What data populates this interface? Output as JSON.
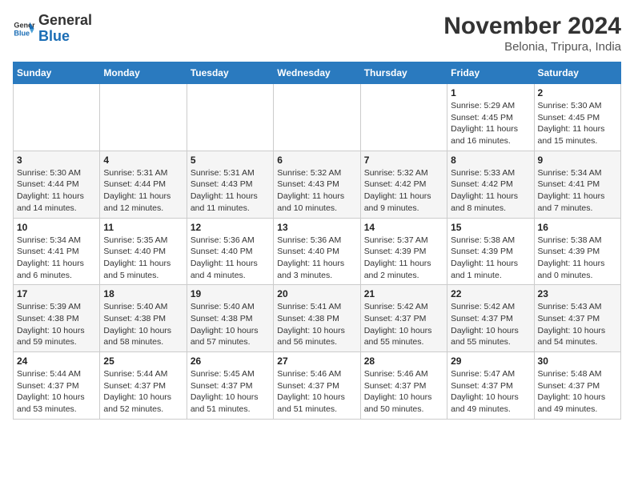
{
  "header": {
    "logo_line1": "General",
    "logo_line2": "Blue",
    "month": "November 2024",
    "location": "Belonia, Tripura, India"
  },
  "weekdays": [
    "Sunday",
    "Monday",
    "Tuesday",
    "Wednesday",
    "Thursday",
    "Friday",
    "Saturday"
  ],
  "weeks": [
    [
      {
        "day": "",
        "info": ""
      },
      {
        "day": "",
        "info": ""
      },
      {
        "day": "",
        "info": ""
      },
      {
        "day": "",
        "info": ""
      },
      {
        "day": "",
        "info": ""
      },
      {
        "day": "1",
        "info": "Sunrise: 5:29 AM\nSunset: 4:45 PM\nDaylight: 11 hours and 16 minutes."
      },
      {
        "day": "2",
        "info": "Sunrise: 5:30 AM\nSunset: 4:45 PM\nDaylight: 11 hours and 15 minutes."
      }
    ],
    [
      {
        "day": "3",
        "info": "Sunrise: 5:30 AM\nSunset: 4:44 PM\nDaylight: 11 hours and 14 minutes."
      },
      {
        "day": "4",
        "info": "Sunrise: 5:31 AM\nSunset: 4:44 PM\nDaylight: 11 hours and 12 minutes."
      },
      {
        "day": "5",
        "info": "Sunrise: 5:31 AM\nSunset: 4:43 PM\nDaylight: 11 hours and 11 minutes."
      },
      {
        "day": "6",
        "info": "Sunrise: 5:32 AM\nSunset: 4:43 PM\nDaylight: 11 hours and 10 minutes."
      },
      {
        "day": "7",
        "info": "Sunrise: 5:32 AM\nSunset: 4:42 PM\nDaylight: 11 hours and 9 minutes."
      },
      {
        "day": "8",
        "info": "Sunrise: 5:33 AM\nSunset: 4:42 PM\nDaylight: 11 hours and 8 minutes."
      },
      {
        "day": "9",
        "info": "Sunrise: 5:34 AM\nSunset: 4:41 PM\nDaylight: 11 hours and 7 minutes."
      }
    ],
    [
      {
        "day": "10",
        "info": "Sunrise: 5:34 AM\nSunset: 4:41 PM\nDaylight: 11 hours and 6 minutes."
      },
      {
        "day": "11",
        "info": "Sunrise: 5:35 AM\nSunset: 4:40 PM\nDaylight: 11 hours and 5 minutes."
      },
      {
        "day": "12",
        "info": "Sunrise: 5:36 AM\nSunset: 4:40 PM\nDaylight: 11 hours and 4 minutes."
      },
      {
        "day": "13",
        "info": "Sunrise: 5:36 AM\nSunset: 4:40 PM\nDaylight: 11 hours and 3 minutes."
      },
      {
        "day": "14",
        "info": "Sunrise: 5:37 AM\nSunset: 4:39 PM\nDaylight: 11 hours and 2 minutes."
      },
      {
        "day": "15",
        "info": "Sunrise: 5:38 AM\nSunset: 4:39 PM\nDaylight: 11 hours and 1 minute."
      },
      {
        "day": "16",
        "info": "Sunrise: 5:38 AM\nSunset: 4:39 PM\nDaylight: 11 hours and 0 minutes."
      }
    ],
    [
      {
        "day": "17",
        "info": "Sunrise: 5:39 AM\nSunset: 4:38 PM\nDaylight: 10 hours and 59 minutes."
      },
      {
        "day": "18",
        "info": "Sunrise: 5:40 AM\nSunset: 4:38 PM\nDaylight: 10 hours and 58 minutes."
      },
      {
        "day": "19",
        "info": "Sunrise: 5:40 AM\nSunset: 4:38 PM\nDaylight: 10 hours and 57 minutes."
      },
      {
        "day": "20",
        "info": "Sunrise: 5:41 AM\nSunset: 4:38 PM\nDaylight: 10 hours and 56 minutes."
      },
      {
        "day": "21",
        "info": "Sunrise: 5:42 AM\nSunset: 4:37 PM\nDaylight: 10 hours and 55 minutes."
      },
      {
        "day": "22",
        "info": "Sunrise: 5:42 AM\nSunset: 4:37 PM\nDaylight: 10 hours and 55 minutes."
      },
      {
        "day": "23",
        "info": "Sunrise: 5:43 AM\nSunset: 4:37 PM\nDaylight: 10 hours and 54 minutes."
      }
    ],
    [
      {
        "day": "24",
        "info": "Sunrise: 5:44 AM\nSunset: 4:37 PM\nDaylight: 10 hours and 53 minutes."
      },
      {
        "day": "25",
        "info": "Sunrise: 5:44 AM\nSunset: 4:37 PM\nDaylight: 10 hours and 52 minutes."
      },
      {
        "day": "26",
        "info": "Sunrise: 5:45 AM\nSunset: 4:37 PM\nDaylight: 10 hours and 51 minutes."
      },
      {
        "day": "27",
        "info": "Sunrise: 5:46 AM\nSunset: 4:37 PM\nDaylight: 10 hours and 51 minutes."
      },
      {
        "day": "28",
        "info": "Sunrise: 5:46 AM\nSunset: 4:37 PM\nDaylight: 10 hours and 50 minutes."
      },
      {
        "day": "29",
        "info": "Sunrise: 5:47 AM\nSunset: 4:37 PM\nDaylight: 10 hours and 49 minutes."
      },
      {
        "day": "30",
        "info": "Sunrise: 5:48 AM\nSunset: 4:37 PM\nDaylight: 10 hours and 49 minutes."
      }
    ]
  ]
}
